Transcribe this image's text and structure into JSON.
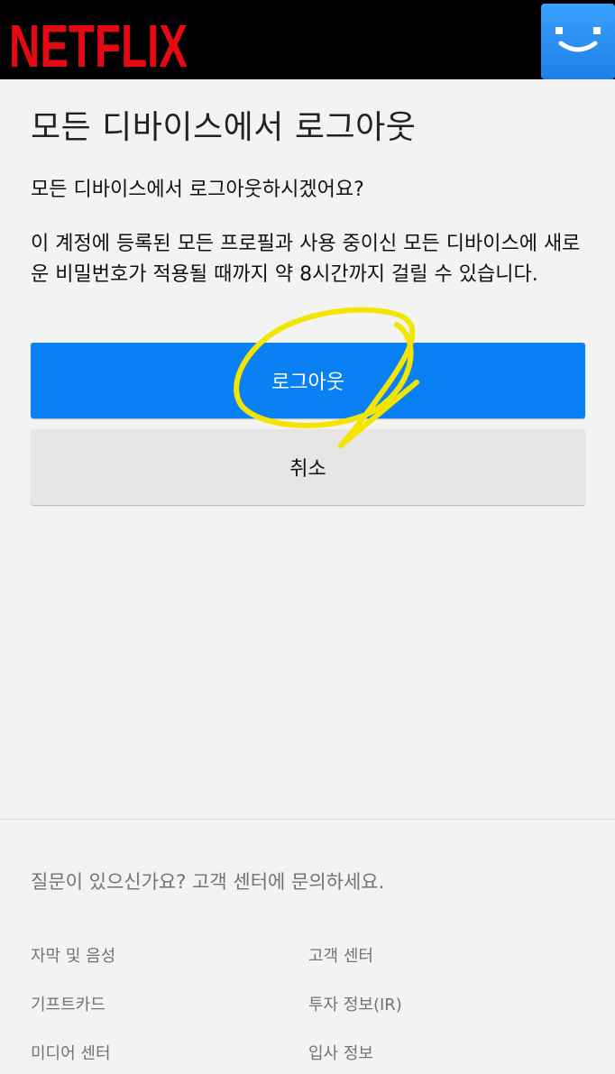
{
  "header": {
    "logo_text": "NETFLIX",
    "brand_color": "#e50914",
    "avatar_icon": "smiley-profile-icon",
    "avatar_color": "#2b8ff0"
  },
  "main": {
    "title": "모든 디바이스에서 로그아웃",
    "question": "모든 디바이스에서 로그아웃하시겠어요?",
    "description": "이 계정에 등록된 모든 프로필과 사용 중이신 모든 디바이스에 새로운 비밀번호가 적용될 때까지 약 8시간까지 걸릴 수 있습니다.",
    "logout_button": "로그아웃",
    "cancel_button": "취소",
    "logout_button_color": "#0a80f5",
    "annotation_color": "#f2e600"
  },
  "footer": {
    "question": "질문이 있으신가요? 고객 센터에 문의하세요.",
    "links": [
      "자막 및 음성",
      "고객 센터",
      "기프트카드",
      "투자 정보(IR)",
      "미디어 센터",
      "입사 정보"
    ]
  }
}
